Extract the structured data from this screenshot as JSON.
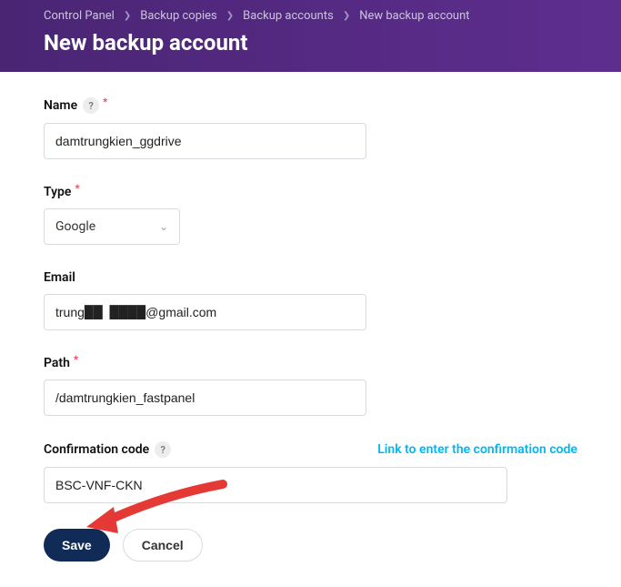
{
  "breadcrumbs": {
    "item1": "Control Panel",
    "item2": "Backup copies",
    "item3": "Backup accounts",
    "item4": "New backup account"
  },
  "page_title": "New backup account",
  "form": {
    "name": {
      "label": "Name",
      "value": "damtrungkien_ggdrive"
    },
    "type": {
      "label": "Type",
      "value": "Google"
    },
    "email": {
      "label": "Email",
      "value": "trung██  ████@gmail.com"
    },
    "path": {
      "label": "Path",
      "value": "/damtrungkien_fastpanel"
    },
    "confirmation": {
      "label": "Confirmation code",
      "link": "Link to enter the confirmation code",
      "value": "BSC-VNF-CKN"
    }
  },
  "buttons": {
    "save": "Save",
    "cancel": "Cancel"
  }
}
